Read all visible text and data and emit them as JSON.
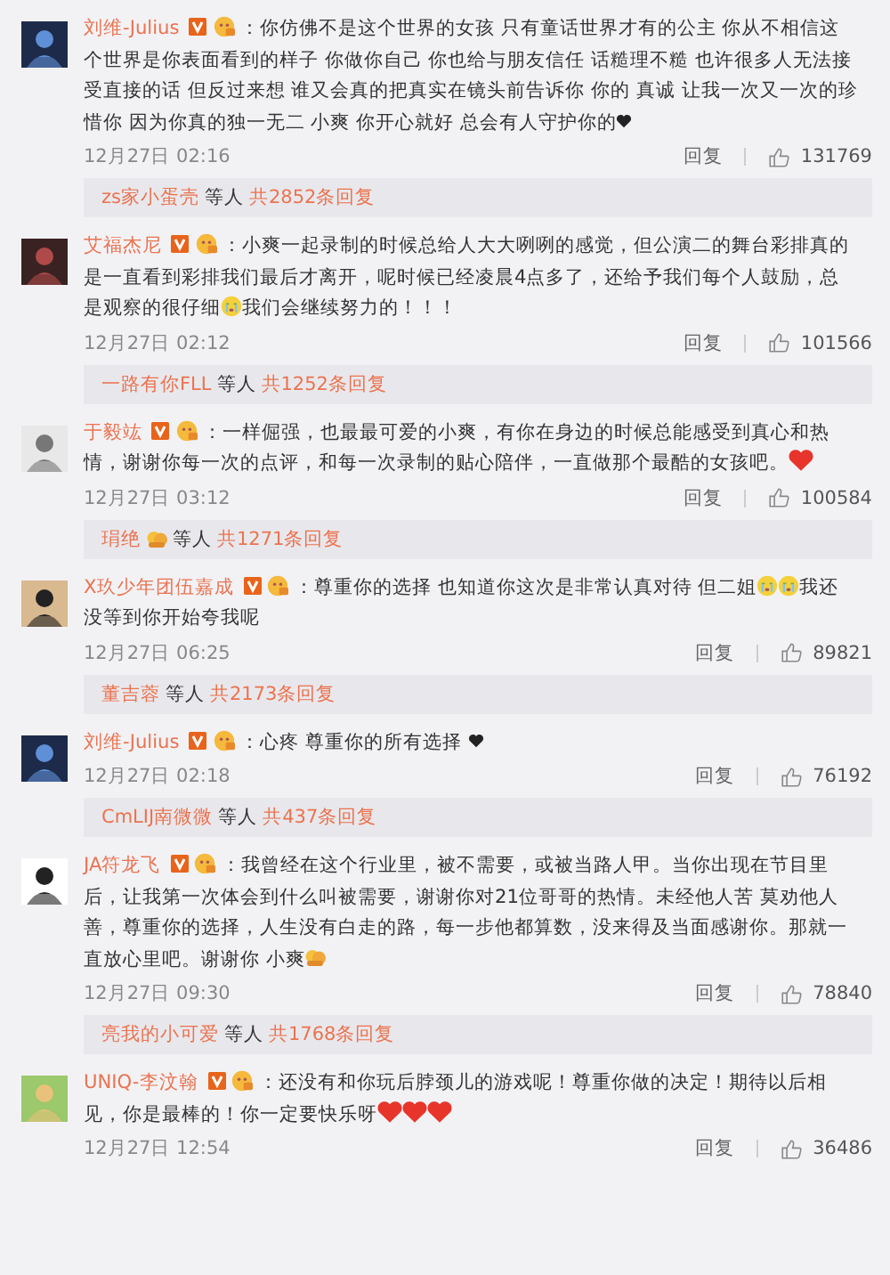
{
  "comments": [
    {
      "user": "刘维-Julius",
      "body": [
        {
          "kind": "text",
          "text": "：你仿佛不是这个世界的女孩 只有童话世界才有的公主 你从不相信这个世界是你表面看到的样子 你做你自己 你也给与朋友信任 话糙理不糙 也许很多人无法接受直接的话 但反过来想 谁又会真的把真实在镜头前告诉你 你的 真诚 让我一次又一次的珍惜你 因为你真的独一无二 小爽 你开心就好 总会有人守护你的"
        },
        {
          "kind": "black-heart"
        }
      ],
      "time": "12月27日 02:16",
      "reply": "回复",
      "likes": "131769",
      "thread": {
        "name": "zs家小蛋壳",
        "emoji": false,
        "suffix": "等人",
        "count": "共2852条回复"
      }
    },
    {
      "user": "艾福杰尼",
      "body": [
        {
          "kind": "text",
          "text": "：小爽一起录制的时候总给人大大咧咧的感觉，但公演二的舞台彩排真的是一直看到彩排我们最后才离开，呢时候已经凌晨4点多了，还给予我们每个人鼓励，总是观察的很仔细"
        },
        {
          "kind": "cry"
        },
        {
          "kind": "text",
          "text": "我们会继续努力的！！！"
        }
      ],
      "time": "12月27日 02:12",
      "reply": "回复",
      "likes": "101566",
      "thread": {
        "name": "一路有你FLL",
        "emoji": false,
        "suffix": "等人",
        "count": "共1252条回复"
      }
    },
    {
      "user": "于毅竑",
      "body": [
        {
          "kind": "text",
          "text": "：一样倔强，也最最可爱的小爽，有你在身边的时候总能感受到真心和热情，谢谢你每一次的点评，和每一次录制的贴心陪伴，一直做那个最酷的女孩吧。"
        },
        {
          "kind": "red-heart"
        }
      ],
      "time": "12月27日 03:12",
      "reply": "回复",
      "likes": "100584",
      "thread": {
        "name": "琄绝",
        "emoji": true,
        "suffix": "等人",
        "count": "共1271条回复"
      }
    },
    {
      "user": "X玖少年团伍嘉成",
      "body": [
        {
          "kind": "text",
          "text": "：尊重你的选择 也知道你这次是非常认真对待  但二姐"
        },
        {
          "kind": "cry"
        },
        {
          "kind": "cry"
        },
        {
          "kind": "text",
          "text": "我还没等到你开始夸我呢"
        }
      ],
      "time": "12月27日 06:25",
      "reply": "回复",
      "likes": "89821",
      "thread": {
        "name": "董吉蓉",
        "emoji": false,
        "suffix": "等人",
        "count": "共2173条回复"
      }
    },
    {
      "user": "刘维-Julius",
      "body": [
        {
          "kind": "text",
          "text": "：心疼 尊重你的所有选择 "
        },
        {
          "kind": "black-heart"
        }
      ],
      "time": "12月27日 02:18",
      "reply": "回复",
      "likes": "76192",
      "thread": {
        "name": "CmLIJ南微微",
        "emoji": false,
        "suffix": "等人",
        "count": "共437条回复"
      }
    },
    {
      "user": "JA符龙飞",
      "body": [
        {
          "kind": "text",
          "text": "：我曾经在这个行业里，被不需要，或被当路人甲。当你出现在节目里后，让我第一次体会到什么叫被需要，谢谢你对21位哥哥的热情。未经他人苦 莫劝他人善，尊重你的选择，人生没有白走的路，每一步他都算数，没来得及当面感谢你。那就一直放心里吧。谢谢你 小爽"
        },
        {
          "kind": "hug"
        }
      ],
      "time": "12月27日 09:30",
      "reply": "回复",
      "likes": "78840",
      "thread": {
        "name": "亮我的小可爱",
        "emoji": false,
        "suffix": "等人",
        "count": "共1768条回复"
      }
    },
    {
      "user": "UNIQ-李汶翰",
      "body": [
        {
          "kind": "text",
          "text": "：还没有和你玩后脖颈儿的游戏呢！尊重你做的决定！期待以后相见，你是最棒的！你一定要快乐呀"
        },
        {
          "kind": "red-heart"
        },
        {
          "kind": "red-heart"
        },
        {
          "kind": "red-heart"
        }
      ],
      "time": "12月27日 12:54",
      "reply": "回复",
      "likes": "36486"
    }
  ]
}
